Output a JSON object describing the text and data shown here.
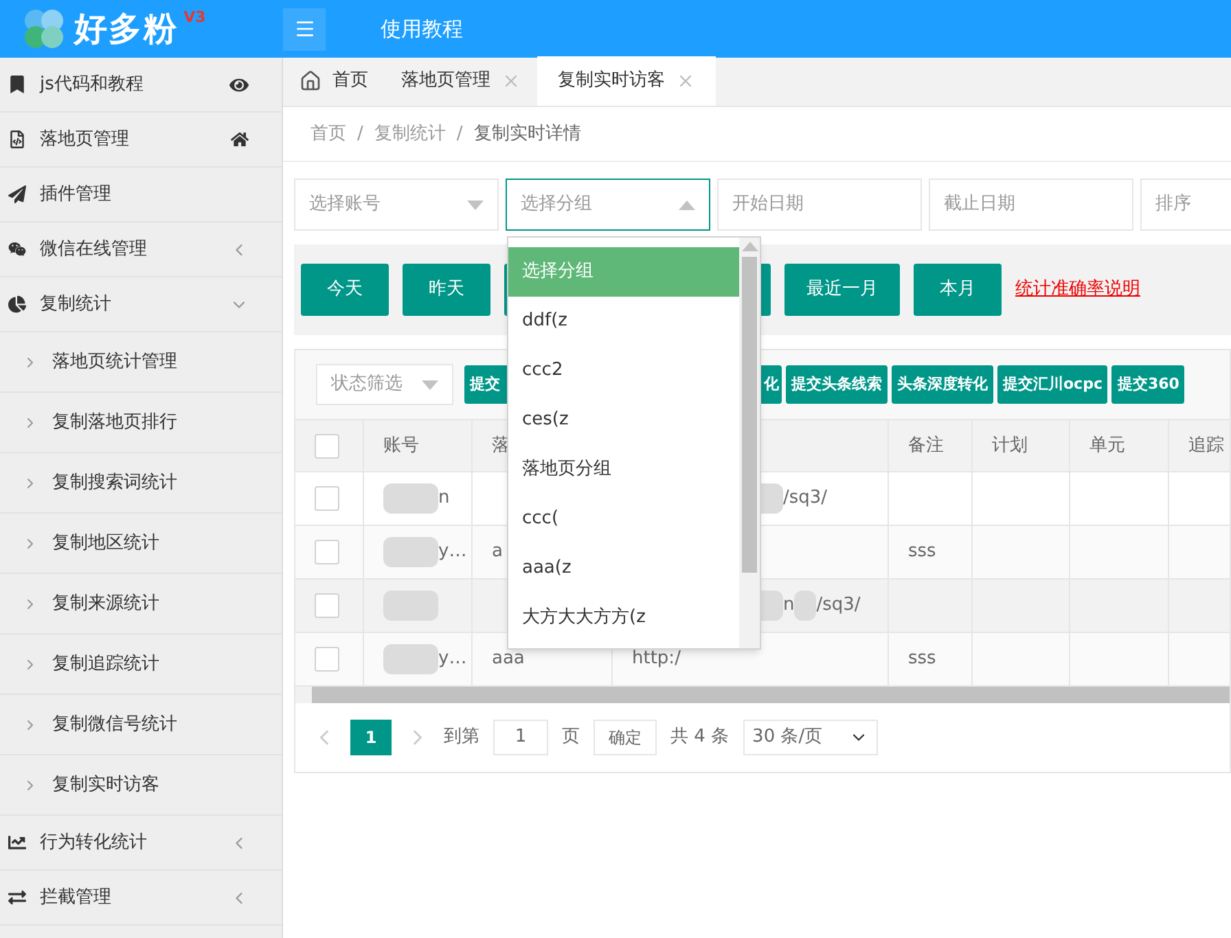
{
  "header": {
    "logo": "好多粉",
    "version": "V3",
    "link": "使用教程"
  },
  "sidebar": {
    "items": [
      {
        "label": "js代码和教程"
      },
      {
        "label": "落地页管理"
      },
      {
        "label": "插件管理"
      },
      {
        "label": "微信在线管理",
        "expanded": false
      },
      {
        "label": "复制统计",
        "expanded": true,
        "children": [
          {
            "label": "落地页统计管理"
          },
          {
            "label": "复制落地页排行"
          },
          {
            "label": "复制搜索词统计"
          },
          {
            "label": "复制地区统计"
          },
          {
            "label": "复制来源统计"
          },
          {
            "label": "复制追踪统计"
          },
          {
            "label": "复制微信号统计"
          },
          {
            "label": "复制实时访客"
          }
        ]
      },
      {
        "label": "行为转化统计",
        "expanded": false
      },
      {
        "label": "拦截管理",
        "expanded": false
      }
    ]
  },
  "tabs": [
    {
      "label": "首页",
      "selected": false
    },
    {
      "label": "落地页管理",
      "selected": false
    },
    {
      "label": "复制实时访客",
      "selected": true
    }
  ],
  "breadcrumb": [
    {
      "label": "首页"
    },
    {
      "separator": "/",
      "label": "复制统计"
    },
    {
      "separator": "/",
      "label": "复制实时详情"
    }
  ],
  "filters": [
    {
      "placeholder": "选择账号",
      "open": false
    },
    {
      "placeholder": "选择分组",
      "open": true
    },
    {
      "placeholder": "开始日期"
    },
    {
      "placeholder": "截止日期"
    },
    {
      "placeholder": "排序"
    }
  ],
  "dropdown": {
    "options": [
      {
        "label": "选择分组",
        "selected": true
      },
      {
        "label": "ddf(z",
        "selected": false
      },
      {
        "label": "ccc2",
        "selected": false
      },
      {
        "label": "ces(z",
        "selected": false
      },
      {
        "label": "落地页分组",
        "selected": false
      },
      {
        "label": "ccc(",
        "selected": false
      },
      {
        "label": "aaa(z",
        "selected": false
      },
      {
        "label": "大方大大方方(z",
        "selected": false
      }
    ]
  },
  "date_buttons": [
    {
      "label": "今天"
    },
    {
      "label": "昨天"
    },
    {
      "label": "最近一月"
    },
    {
      "label": "本月"
    }
  ],
  "accuracy_link": "统计准确率说明",
  "status_filter": {
    "placeholder": "状态筛选"
  },
  "action_buttons": [
    {
      "label": "提交"
    },
    {
      "label": "化"
    },
    {
      "label": "提交头条线索"
    },
    {
      "label": "头条深度转化"
    },
    {
      "label": "提交汇川ocpc"
    },
    {
      "label": "提交360"
    }
  ],
  "table": {
    "all_checked": false,
    "columns": [
      "",
      "账号",
      "落",
      "",
      "备注",
      "计划",
      "单元",
      "追踪"
    ],
    "rows": [
      {
        "checked": false,
        "cells": [
          {},
          {
            "text": "n",
            "redacted": true
          },
          {},
          {
            "text": "/sq3/",
            "redacted": true
          },
          {},
          {},
          {},
          {}
        ]
      },
      {
        "checked": false,
        "cells": [
          {},
          {
            "text": "y…",
            "redacted": true
          },
          {
            "text": "a"
          },
          {},
          {
            "text": "sss"
          },
          {},
          {},
          {}
        ]
      },
      {
        "checked": false,
        "cells": [
          {},
          {
            "redacted": true
          },
          {},
          {
            "text": "n",
            "redacted": true,
            "after": "/sq3/"
          },
          {},
          {},
          {},
          {}
        ]
      },
      {
        "checked": false,
        "cells": [
          {},
          {
            "text": "y…",
            "redacted": true
          },
          {
            "text": "aaa"
          },
          {
            "text": "http:/"
          },
          {
            "text": "sss"
          },
          {},
          {},
          {}
        ]
      }
    ]
  },
  "pagination": {
    "pages": [
      {
        "label": "1",
        "selected": true
      }
    ],
    "goto_label": "到第",
    "goto_value": "1",
    "page_unit": "页",
    "confirm": "确定",
    "total": "共 4 条",
    "page_size": "30 条/页"
  }
}
